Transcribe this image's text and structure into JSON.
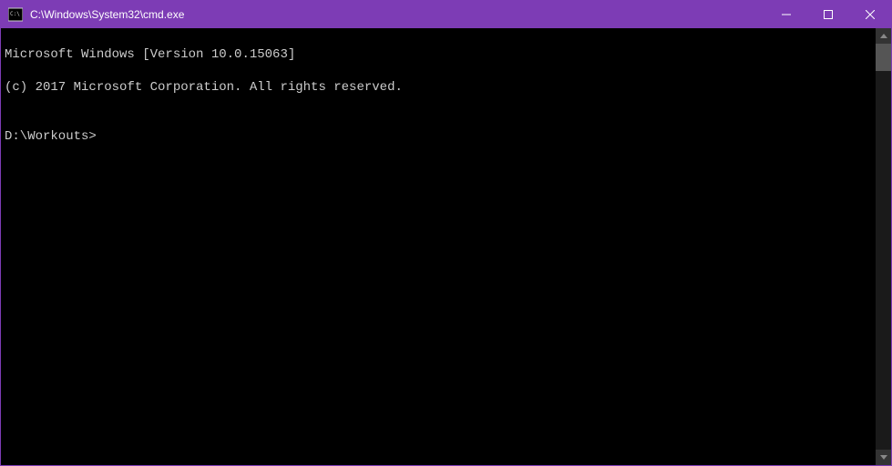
{
  "titlebar": {
    "title": "C:\\Windows\\System32\\cmd.exe",
    "icon_label": "cmd-icon"
  },
  "controls": {
    "minimize": "minimize",
    "maximize": "maximize",
    "close": "close"
  },
  "console": {
    "line1": "Microsoft Windows [Version 10.0.15063]",
    "line2": "(c) 2017 Microsoft Corporation. All rights reserved.",
    "blank": "",
    "prompt": "D:\\Workouts>"
  }
}
